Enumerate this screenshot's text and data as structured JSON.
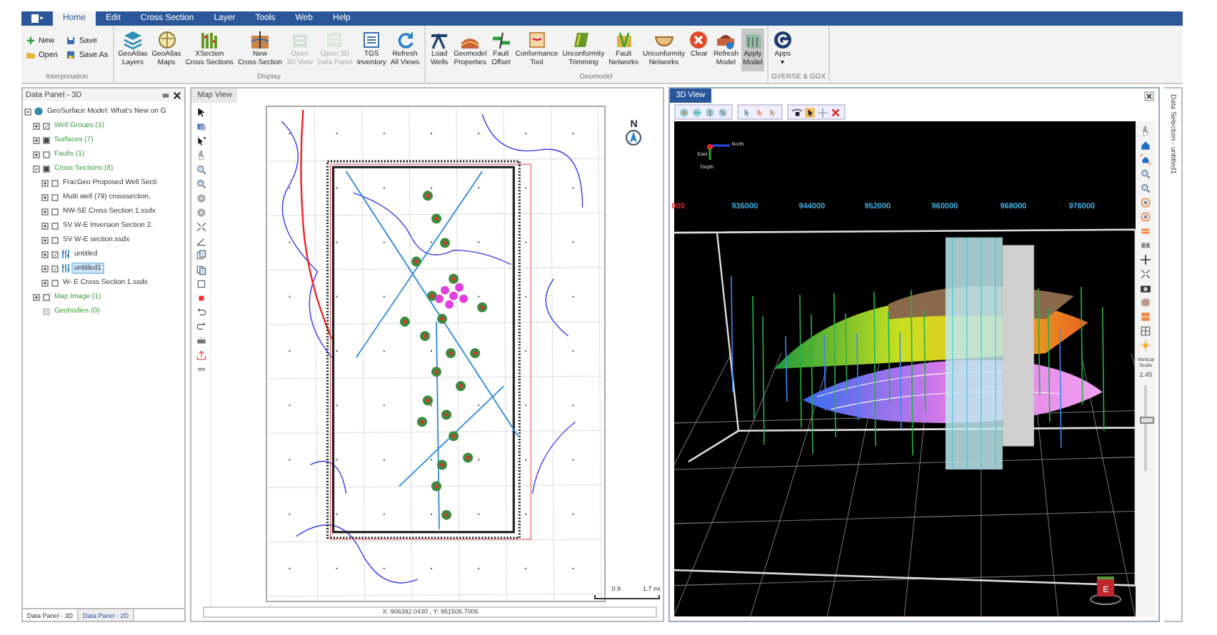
{
  "ribbon": {
    "tabs": [
      {
        "label": "Home",
        "selected": true
      },
      {
        "label": "Edit",
        "selected": false
      },
      {
        "label": "Cross Section",
        "selected": false
      },
      {
        "label": "Layer",
        "selected": false
      },
      {
        "label": "Tools",
        "selected": false
      },
      {
        "label": "Web",
        "selected": false
      },
      {
        "label": "Help",
        "selected": false
      }
    ],
    "groups": [
      {
        "title": "Interpretation",
        "buttons": [
          {
            "label": "New",
            "kind": "small",
            "disabled": false,
            "highlighted": false
          },
          {
            "label": "Save",
            "kind": "small",
            "disabled": false,
            "highlighted": false
          },
          {
            "label": "Open",
            "kind": "small",
            "disabled": false,
            "highlighted": false
          },
          {
            "label": "Save As",
            "kind": "small",
            "disabled": false,
            "highlighted": false
          }
        ]
      },
      {
        "title": "Display",
        "buttons": [
          {
            "label": "GeoAtlas\nLayers",
            "kind": "large",
            "disabled": false,
            "highlighted": false
          },
          {
            "label": "GeoAtlas\nMaps",
            "kind": "large",
            "disabled": false,
            "highlighted": false
          },
          {
            "label": "XSection\nCross Sections",
            "kind": "large",
            "disabled": false,
            "highlighted": false
          },
          {
            "label": "New\nCross Section",
            "kind": "large",
            "disabled": false,
            "highlighted": false
          },
          {
            "label": "Open\n3D View",
            "kind": "large",
            "disabled": true,
            "highlighted": false
          },
          {
            "label": "Open 3D\nData Panel",
            "kind": "large",
            "disabled": true,
            "highlighted": false
          },
          {
            "label": "TGS\nInventory",
            "kind": "large",
            "disabled": false,
            "highlighted": false
          },
          {
            "label": "Refresh\nAll Views",
            "kind": "large",
            "disabled": false,
            "highlighted": false
          }
        ]
      },
      {
        "title": "Geomodel",
        "buttons": [
          {
            "label": "Load\nWells",
            "kind": "large",
            "disabled": false,
            "highlighted": false
          },
          {
            "label": "Geomodel\nProperties",
            "kind": "large",
            "disabled": false,
            "highlighted": false
          },
          {
            "label": "Fault\nOffset",
            "kind": "large",
            "disabled": false,
            "highlighted": false
          },
          {
            "label": "Conformance\nTool",
            "kind": "large",
            "disabled": false,
            "highlighted": false
          },
          {
            "label": "Unconformity\nTrimming",
            "kind": "large",
            "disabled": false,
            "highlighted": false
          },
          {
            "label": "Fault\nNetworks",
            "kind": "large",
            "disabled": false,
            "highlighted": false
          },
          {
            "label": "Unconformity\nNetworks",
            "kind": "large",
            "disabled": false,
            "highlighted": false
          },
          {
            "label": "Clear",
            "kind": "large",
            "disabled": false,
            "highlighted": false
          },
          {
            "label": "Refresh\nModel",
            "kind": "large",
            "disabled": false,
            "highlighted": false
          },
          {
            "label": "Apply\nModel",
            "kind": "large",
            "disabled": false,
            "highlighted": true
          }
        ]
      },
      {
        "title": "GVERSE & GGX",
        "buttons": [
          {
            "label": "Apps\n▾",
            "kind": "large",
            "disabled": false,
            "highlighted": false
          }
        ]
      }
    ]
  },
  "data_panel": {
    "title": "Data Panel - 3D",
    "tree": {
      "label": "GeoSurface Model: What's New on G",
      "kind": "model",
      "expanded": true,
      "selected": false,
      "children": [
        {
          "label": "Well Groups (1)",
          "kind": "category",
          "checked": true,
          "partial": false,
          "disabled": false,
          "expanded": false,
          "selected": false
        },
        {
          "label": "Surfaces (7)",
          "kind": "category",
          "checked": false,
          "partial": true,
          "disabled": false,
          "expanded": false,
          "selected": false
        },
        {
          "label": "Faults (1)",
          "kind": "category",
          "checked": false,
          "partial": false,
          "disabled": false,
          "expanded": false,
          "selected": false
        },
        {
          "label": "Cross Sections (8)",
          "kind": "category",
          "checked": false,
          "partial": true,
          "disabled": false,
          "expanded": true,
          "selected": false,
          "children": [
            {
              "label": "FracGeo Proposed Well Secti",
              "kind": "file",
              "checked": false,
              "partial": false,
              "disabled": false,
              "expanded": false,
              "selected": false
            },
            {
              "label": "Multi well (79) crosssection.",
              "kind": "file",
              "checked": false,
              "partial": false,
              "disabled": false,
              "expanded": false,
              "selected": false
            },
            {
              "label": "NW-SE Cross Section 1.ssdx",
              "kind": "file",
              "checked": false,
              "partial": false,
              "disabled": false,
              "expanded": false,
              "selected": false
            },
            {
              "label": "SV W-E Inversion Section 2.",
              "kind": "file",
              "checked": false,
              "partial": false,
              "disabled": false,
              "expanded": false,
              "selected": false
            },
            {
              "label": "SV W-E section.ssdx",
              "kind": "file",
              "checked": false,
              "partial": false,
              "disabled": false,
              "expanded": false,
              "selected": false
            },
            {
              "label": "untitled",
              "kind": "section",
              "checked": true,
              "partial": false,
              "disabled": false,
              "expanded": false,
              "selected": false
            },
            {
              "label": "untitled1",
              "kind": "section",
              "checked": true,
              "partial": false,
              "disabled": false,
              "expanded": false,
              "selected": true
            },
            {
              "label": "W- E Cross Section 1.ssdx",
              "kind": "file",
              "checked": false,
              "partial": false,
              "disabled": false,
              "expanded": false,
              "selected": false
            }
          ]
        },
        {
          "label": "Map Image (1)",
          "kind": "category",
          "checked": false,
          "partial": false,
          "disabled": false,
          "expanded": false,
          "selected": false
        },
        {
          "label": "Geobodies (0)",
          "kind": "category",
          "checked": false,
          "partial": false,
          "disabled": true,
          "selected": false
        }
      ]
    },
    "bottom_tabs": [
      {
        "label": "Data Panel - 3D",
        "selected": true
      },
      {
        "label": "Data Panel - 2D",
        "selected": false
      }
    ]
  },
  "map_view": {
    "title": "Map View",
    "north_label": "N",
    "scale_labels": [
      "0.9",
      "1.7 mi"
    ],
    "coordinates": "X: 906392.0430 , Y: 951506.7006"
  },
  "view_3d": {
    "title": "3D View",
    "axis_labels": [
      "000",
      "936000",
      "944000",
      "952000",
      "960000",
      "968000",
      "976000"
    ],
    "compass": {
      "north": "North",
      "east": "East",
      "depth": "Depth"
    },
    "vertical_scale": {
      "label": "Vertical\nScale",
      "value": "2.45",
      "level": 0.62
    },
    "view_cube_label": "E",
    "side_tab": "Data Selection - untitled1"
  }
}
